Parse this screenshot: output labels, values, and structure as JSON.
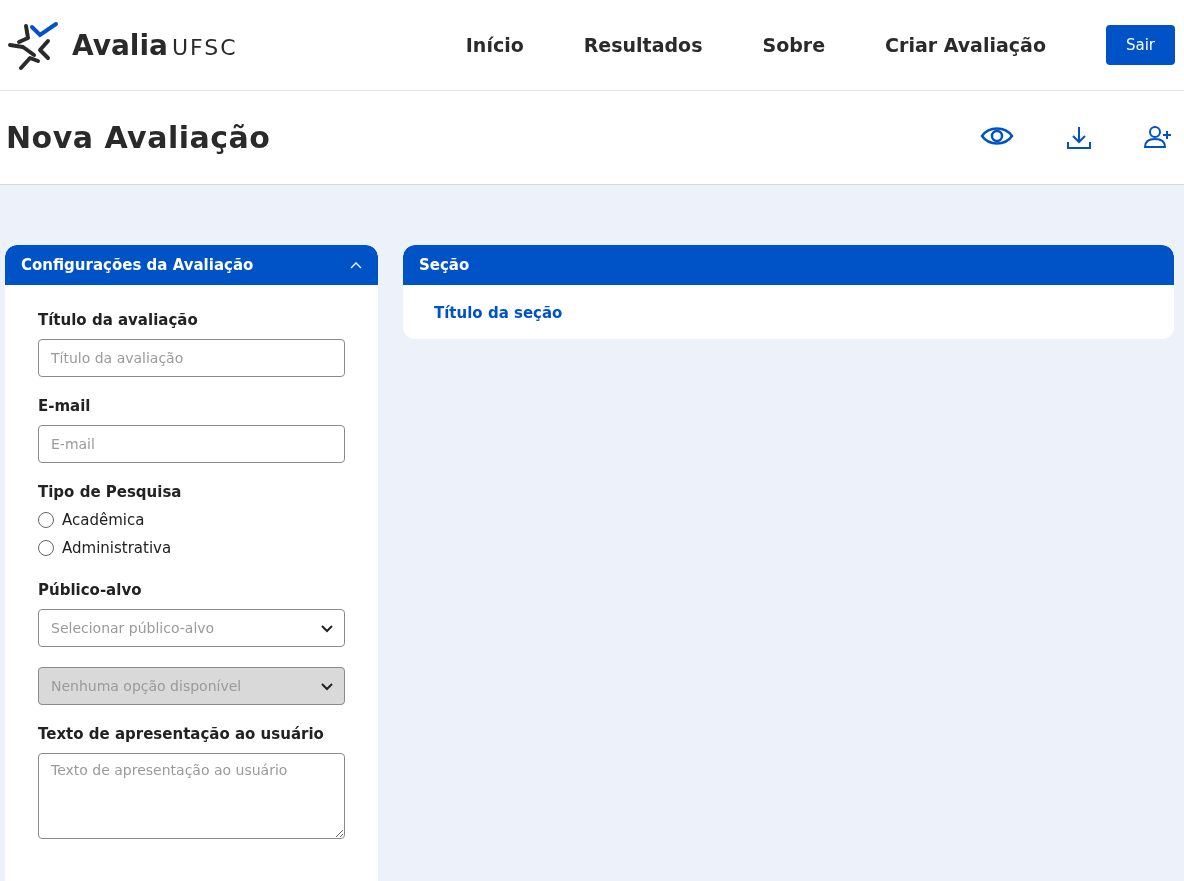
{
  "header": {
    "logo": {
      "name": "Avalia",
      "suffix": "UFSC"
    },
    "nav": [
      {
        "label": "Início"
      },
      {
        "label": "Resultados"
      },
      {
        "label": "Sobre"
      },
      {
        "label": "Criar Avaliação"
      }
    ],
    "logout": "Sair"
  },
  "page": {
    "title": "Nova Avaliação"
  },
  "settings_panel": {
    "title": "Configurações da Avaliação",
    "expanded": true,
    "fields": [
      {
        "kind": "text",
        "label": "Título da avaliação",
        "placeholder": "Título da avaliação"
      },
      {
        "kind": "text",
        "label": "E-mail",
        "placeholder": "E-mail"
      },
      {
        "kind": "radio",
        "label": "Tipo de Pesquisa",
        "options": [
          {
            "label": "Acadêmica",
            "selected": false
          },
          {
            "label": "Administrativa",
            "selected": false
          }
        ]
      },
      {
        "kind": "select",
        "label": "Público-alvo",
        "placeholder": "Selecionar público-alvo",
        "disabled": false
      },
      {
        "kind": "select",
        "placeholder": "Nenhuma opção disponível",
        "disabled": true
      },
      {
        "kind": "textarea",
        "label": "Texto de apresentação ao usuário",
        "placeholder": "Texto de apresentação ao usuário"
      }
    ]
  },
  "section_panel": {
    "title": "Seção",
    "section_title": "Título da seção"
  }
}
